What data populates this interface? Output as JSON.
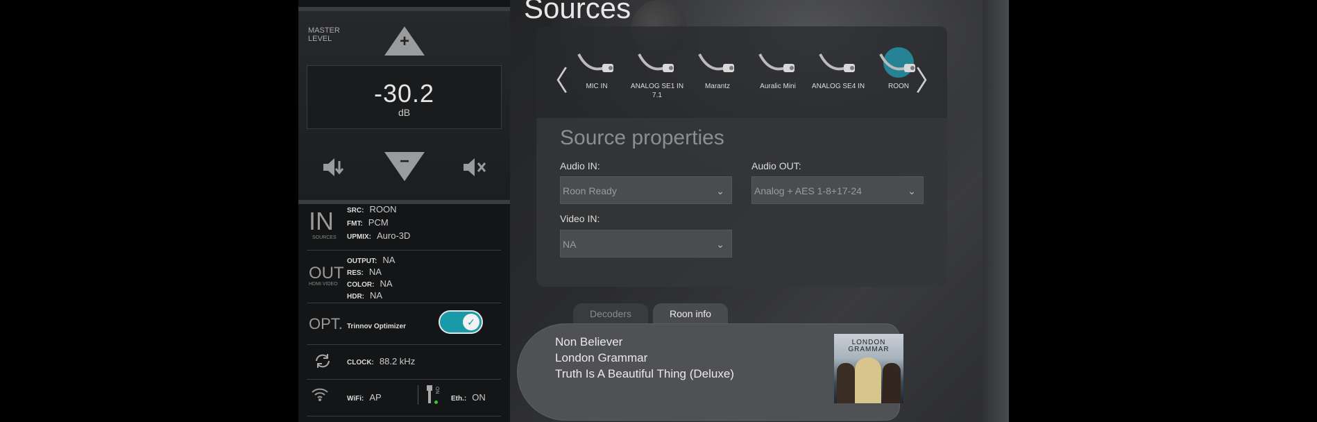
{
  "master": {
    "label_line1": "MASTER",
    "label_line2": "LEVEL",
    "plus": "+",
    "minus": "−",
    "value": "-30.2",
    "unit": "dB"
  },
  "in_section": {
    "big": "IN",
    "sub": "SOURCES",
    "rows": [
      {
        "key": "SRC:",
        "value": "ROON"
      },
      {
        "key": "FMT:",
        "value": "PCM"
      },
      {
        "key": "UPMIX:",
        "value": "Auro-3D"
      }
    ]
  },
  "out_section": {
    "big": "OUT",
    "sub": "HDMI VIDEO",
    "rows": [
      {
        "key": "OUTPUT:",
        "value": "NA"
      },
      {
        "key": "RES:",
        "value": "NA"
      },
      {
        "key": "COLOR:",
        "value": "NA"
      },
      {
        "key": "HDR:",
        "value": "NA"
      }
    ]
  },
  "opt_section": {
    "big": "OPT.",
    "label": "Trinnov Optimizer",
    "toggle_on": true,
    "check": "✓"
  },
  "clock": {
    "key": "CLOCK:",
    "value": "88.2 kHz"
  },
  "network": {
    "wifi_key": "WiFi:",
    "wifi_value": "AP",
    "eth_icon_text": "ON",
    "eth_key": "Eth.:",
    "eth_value": "ON"
  },
  "page_title": "Sources",
  "carousel": {
    "prev": "〈",
    "next": "〉",
    "items": [
      {
        "label": "MIC IN",
        "selected": false
      },
      {
        "label": "ANALOG SE1 IN 7.1",
        "selected": false
      },
      {
        "label": "Marantz",
        "selected": false
      },
      {
        "label": "Auralic Mini",
        "selected": false
      },
      {
        "label": "ANALOG SE4 IN",
        "selected": false
      },
      {
        "label": "ROON",
        "selected": true
      }
    ]
  },
  "properties": {
    "title": "Source properties",
    "audio_in_label": "Audio IN:",
    "audio_in_value": "Roon Ready",
    "audio_out_label": "Audio OUT:",
    "audio_out_value": "Analog + AES 1-8+17-24",
    "video_in_label": "Video IN:",
    "video_in_value": "NA",
    "chevron": "⌄"
  },
  "tabs": {
    "decoders": "Decoders",
    "roon_info": "Roon info"
  },
  "now_playing": {
    "track": "Non Believer",
    "artist": "London Grammar",
    "album": "Truth Is A Beautiful Thing (Deluxe)",
    "art_text_1": "LONDON",
    "art_text_2": "GRAMMAR"
  },
  "colors": {
    "accent": "#1a9aa8",
    "selected_glow": "#1ec8e6"
  }
}
